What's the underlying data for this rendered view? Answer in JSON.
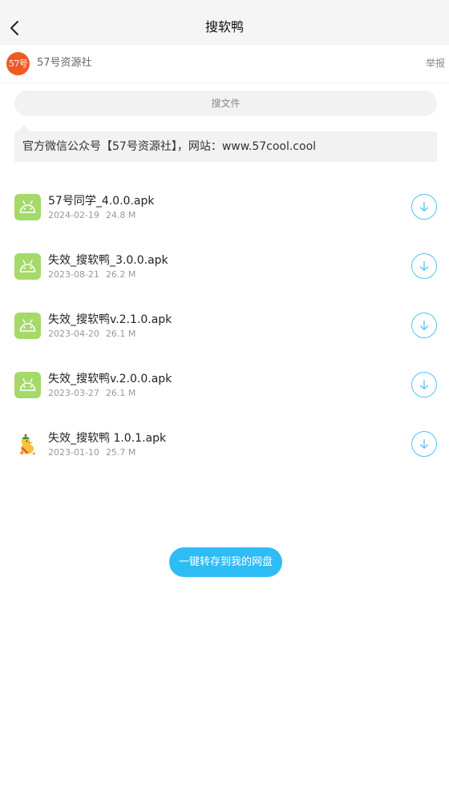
{
  "header": {
    "title": "搜软鸭",
    "back_icon": "chevron-left-icon"
  },
  "owner": {
    "avatar_text": "57号",
    "name": "57号资源社",
    "report_label": "举报"
  },
  "search": {
    "placeholder": "搜文件"
  },
  "notice": {
    "text": "官方微信公众号【57号资源社】，网站：www.57cool.cool"
  },
  "files": [
    {
      "name": "57号同学_4.0.0.apk",
      "date": "2024-02-19",
      "size": "24.8 M",
      "icon": "android-icon"
    },
    {
      "name": "失效_搜软鸭_3.0.0.apk",
      "date": "2023-08-21",
      "size": "26.2 M",
      "icon": "android-icon"
    },
    {
      "name": "失效_搜软鸭v.2.1.0.apk",
      "date": "2023-04-20",
      "size": "26.1 M",
      "icon": "android-icon"
    },
    {
      "name": "失效_搜软鸭v.2.0.0.apk",
      "date": "2023-03-27",
      "size": "26.1 M",
      "icon": "android-icon"
    },
    {
      "name": "失效_搜软鸭 1.0.1.apk",
      "date": "2023-01-10",
      "size": "25.7 M",
      "icon": "duck-app-icon"
    }
  ],
  "actions": {
    "save_to_drive_label": "一键转存到我的网盘"
  },
  "colors": {
    "accent": "#2ebcf5",
    "avatar": "#f05a22",
    "android_icon": "#a5d96a"
  }
}
